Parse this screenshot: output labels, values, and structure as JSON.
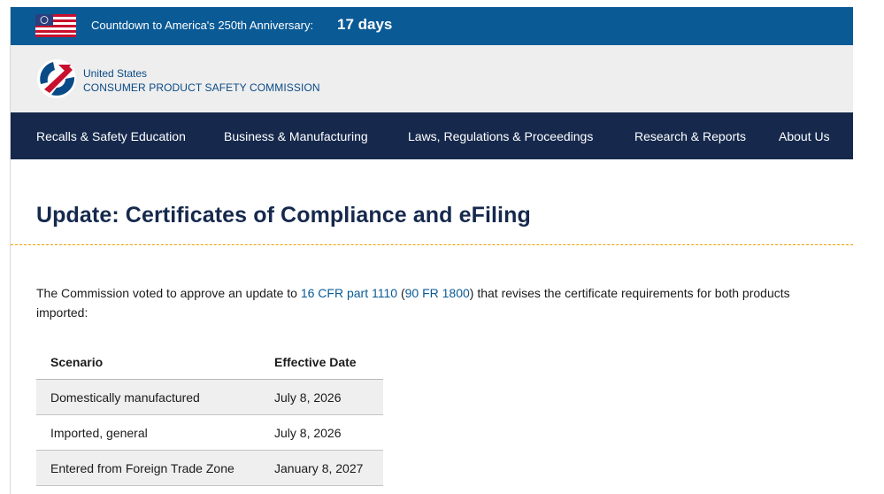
{
  "banner": {
    "text": "Countdown to America's 250th Anniversary:",
    "days": "17 days"
  },
  "header": {
    "agency_line1": "United States",
    "agency_line2": "CONSUMER PRODUCT SAFETY COMMISSION"
  },
  "nav": {
    "items": [
      {
        "label": "Recalls & Safety Education"
      },
      {
        "label": "Business & Manufacturing"
      },
      {
        "label": "Laws, Regulations & Proceedings"
      },
      {
        "label": "Research & Reports"
      },
      {
        "label": "About Us"
      }
    ]
  },
  "main": {
    "title": "Update: Certificates of Compliance and eFiling",
    "intro_before": "The Commission voted to approve an update to ",
    "link1": "16 CFR part 1110",
    "intro_mid1": " (",
    "link2": "90 FR 1800",
    "intro_after": ") that revises the certificate requirements for both products",
    "intro_line2": "imported:"
  },
  "table": {
    "headers": [
      "Scenario",
      "Effective Date"
    ],
    "rows": [
      {
        "scenario": "Domestically manufactured",
        "date": "July 8, 2026"
      },
      {
        "scenario": "Imported, general",
        "date": "July 8, 2026"
      },
      {
        "scenario": "Entered from Foreign Trade Zone",
        "date": "January 8, 2027"
      }
    ]
  },
  "colors": {
    "banner_bg": "#0a5a96",
    "nav_bg": "#16294d",
    "title": "#16294d",
    "link": "#0a5a96",
    "divider": "#f0a000"
  }
}
